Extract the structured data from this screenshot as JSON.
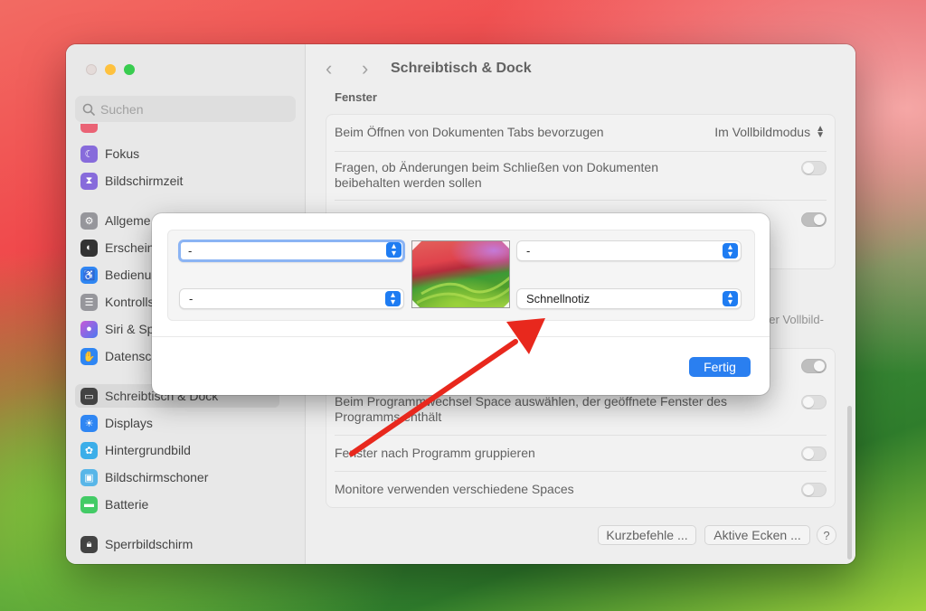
{
  "window": {
    "title": "Schreibtisch & Dock",
    "nav_back": "‹",
    "nav_forward": "›"
  },
  "sidebar": {
    "search_placeholder": "Suchen",
    "items": [
      {
        "label": "Fokus",
        "icon": "moon-icon",
        "color": "#7d5fd8"
      },
      {
        "label": "Bildschirmzeit",
        "icon": "hourglass-icon",
        "color": "#7d5fd8"
      },
      {
        "label": "Allgemein",
        "icon": "gear-icon",
        "color": "#8e8e93"
      },
      {
        "label": "Erscheinungsbild",
        "icon": "appearance-icon",
        "color": "#222222"
      },
      {
        "label": "Bedienungshilfen",
        "icon": "accessibility-icon",
        "color": "#1e7cf2"
      },
      {
        "label": "Kontrollzentrum",
        "icon": "toggles-icon",
        "color": "#8e8e93"
      },
      {
        "label": "Siri & Spotlight",
        "icon": "siri-icon",
        "color": "#c44bd4"
      },
      {
        "label": "Datenschutz & Sicherheit",
        "icon": "hand-icon",
        "color": "#1e7cf2"
      },
      {
        "label": "Schreibtisch & Dock",
        "icon": "dock-icon",
        "color": "#333333"
      },
      {
        "label": "Displays",
        "icon": "sun-icon",
        "color": "#1e7cf2"
      },
      {
        "label": "Hintergrundbild",
        "icon": "flower-icon",
        "color": "#2ba8e8"
      },
      {
        "label": "Bildschirmschoner",
        "icon": "screensaver-icon",
        "color": "#4ab0e6"
      },
      {
        "label": "Batterie",
        "icon": "battery-icon",
        "color": "#34c759"
      },
      {
        "label": "Sperrbildschirm",
        "icon": "lock-icon",
        "color": "#333333"
      }
    ],
    "sidebar_vis": [
      {
        "label": "Fokus"
      },
      {
        "label": "Bildschirmzeit"
      },
      {
        "label": "Allgeme"
      },
      {
        "label": "Erschein"
      },
      {
        "label": "Bedienu"
      },
      {
        "label": "Kontrolls"
      },
      {
        "label": "Siri & Sp"
      },
      {
        "label": "Datensc"
      },
      {
        "label": "Schreibtisch & Dock"
      },
      {
        "label": "Displays"
      },
      {
        "label": "Hintergrundbild"
      },
      {
        "label": "Bildschirmschoner"
      },
      {
        "label": "Batterie"
      },
      {
        "label": "Sperrbildschirm"
      }
    ]
  },
  "content": {
    "section_header": "Fenster",
    "rows": {
      "tabs_label": "Beim Öffnen von Dokumenten Tabs bevorzugen",
      "tabs_value": "Im Vollbildmodus",
      "ask_keep_label": "Fragen, ob Änderungen beim Schließen von Dokumenten beibehalten werden sollen",
      "partial_right_text": "er Vollbild-",
      "switch_space_label": "Beim Programmwechsel Space auswählen, der geöffnete Fenster des Programms enthält",
      "group_label": "Fenster nach Programm gruppieren",
      "monitors_label": "Monitore verwenden verschiedene Spaces"
    },
    "buttons": {
      "shortcuts": "Kurzbefehle ...",
      "hot_corners": "Aktive Ecken ...",
      "help": "?"
    }
  },
  "hot_corners_sheet": {
    "top_left": "-",
    "top_right": "-",
    "bottom_left": "-",
    "bottom_right": "Schnellnotiz",
    "done_button": "Fertig"
  },
  "colors": {
    "accent": "#1e7cf2",
    "annotation_arrow": "#e8281d"
  }
}
